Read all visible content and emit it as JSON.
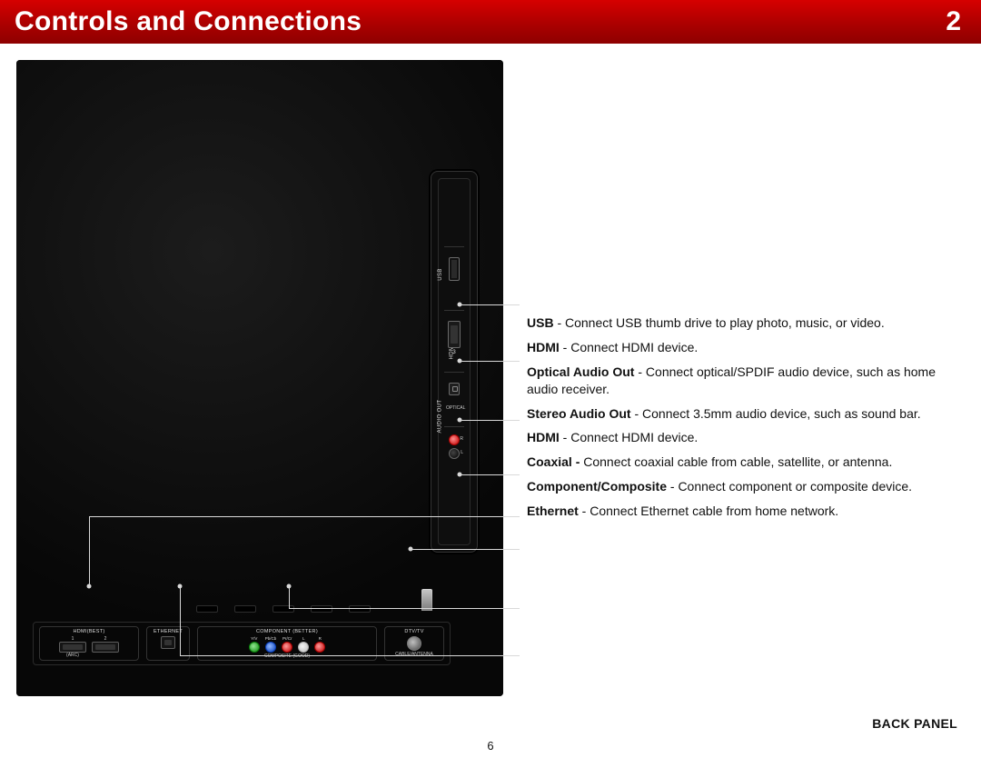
{
  "header": {
    "title": "Controls and Connections",
    "chapter": "2"
  },
  "page_number": "6",
  "back_panel_label": "BACK PANEL",
  "side_panel": {
    "usb": {
      "label": "USB"
    },
    "hdmi_side": {
      "label": "HDMI(BEST)",
      "number": "3"
    },
    "audio_out_group": "AUDIO OUT",
    "optical": {
      "label": "OPTICAL"
    },
    "stereo": {
      "r": "R",
      "l": "L"
    }
  },
  "bottom_panel": {
    "hdmi": {
      "label": "HDMI(BEST)",
      "n1": "1",
      "arc": "(ARC)",
      "n2": "2"
    },
    "ethernet": {
      "label": "ETHERNET"
    },
    "component": {
      "label": "COMPONENT (BETTER)",
      "sub": "COMPOSITE (GOOD)",
      "ports": [
        {
          "name": "Y/V",
          "color": "green"
        },
        {
          "name": "Pb/Cb",
          "color": "blue"
        },
        {
          "name": "Pr/Cr",
          "color": "red"
        },
        {
          "name": "L",
          "color": "white"
        },
        {
          "name": "R",
          "color": "red"
        }
      ]
    },
    "dtv": {
      "label": "DTV/TV",
      "sub": "CABLE/ANTENNA"
    }
  },
  "descriptions": [
    {
      "term": "USB",
      "text": " - Connect USB thumb drive to play photo, music, or video."
    },
    {
      "term": "HDMI",
      "text": " - Connect HDMI device."
    },
    {
      "term": "Optical Audio Out",
      "text": " - Connect optical/SPDIF audio device, such as home audio receiver."
    },
    {
      "term": "Stereo Audio Out",
      "text": " - Connect 3.5mm audio device, such as sound bar."
    },
    {
      "term": "HDMI",
      "text": " - Connect HDMI device."
    },
    {
      "term": "Coaxial - ",
      "text": "Connect coaxial cable from cable, satellite, or antenna."
    },
    {
      "term": "Component/Composite",
      "text": " - Connect component or composite device."
    },
    {
      "term": "Ethernet",
      "text": " - Connect Ethernet cable from home network."
    }
  ]
}
